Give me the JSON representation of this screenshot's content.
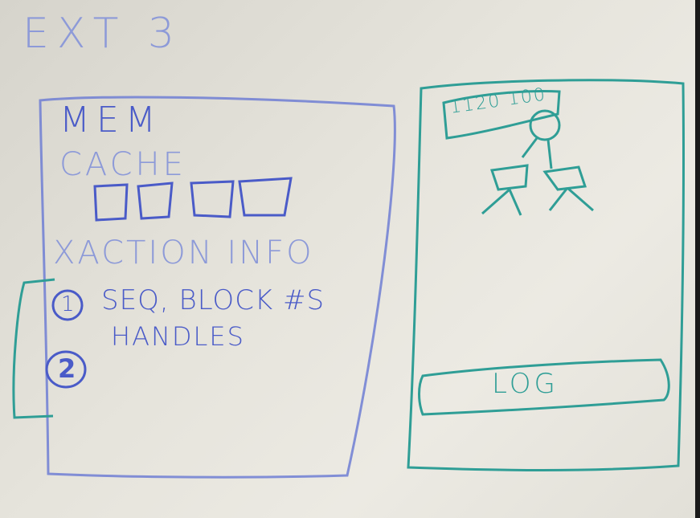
{
  "board": {
    "title": "EXT 3",
    "left_panel": {
      "heading": "MEM",
      "cache_label": "CACHE",
      "xaction_label": "XACTION INFO",
      "item_1_marker": "1",
      "item_1_text": "SEQ, BLOCK #S",
      "item_1_subtext": "HANDLES",
      "item_2_marker": "2"
    },
    "right_panel": {
      "header_text": "1120 100",
      "log_label": "LOG"
    }
  },
  "colors": {
    "marker_blue": "#4a5bc8",
    "marker_teal": "#2f9e96",
    "whiteboard": "#e6e4dc"
  }
}
